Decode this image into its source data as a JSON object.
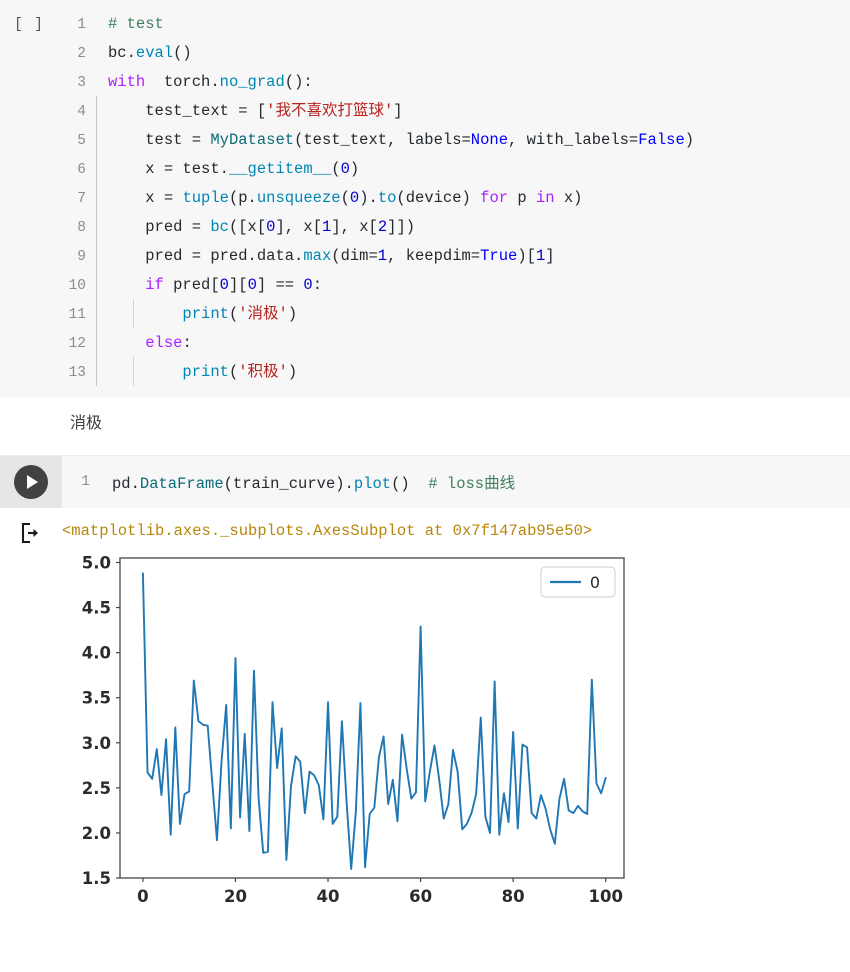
{
  "notebook": {
    "cell1": {
      "prompt": "[ ]",
      "lines": [
        {
          "n": "1",
          "indent": 0,
          "tokens": [
            {
              "t": "# test",
              "c": "tok-com"
            }
          ]
        },
        {
          "n": "2",
          "indent": 0,
          "tokens": [
            {
              "t": "bc.",
              "c": "tok-plain"
            },
            {
              "t": "eval",
              "c": "tok-fn"
            },
            {
              "t": "()",
              "c": "tok-plain"
            }
          ]
        },
        {
          "n": "3",
          "indent": 0,
          "tokens": [
            {
              "t": "with",
              "c": "tok-kw"
            },
            {
              "t": "  torch.",
              "c": "tok-plain"
            },
            {
              "t": "no_grad",
              "c": "tok-fn"
            },
            {
              "t": "():",
              "c": "tok-plain"
            }
          ]
        },
        {
          "n": "4",
          "indent": 1,
          "tokens": [
            {
              "t": "test_text = [",
              "c": "tok-plain"
            },
            {
              "t": "'我不喜欢打篮球'",
              "c": "tok-str"
            },
            {
              "t": "]",
              "c": "tok-plain"
            }
          ]
        },
        {
          "n": "5",
          "indent": 1,
          "tokens": [
            {
              "t": "test = ",
              "c": "tok-plain"
            },
            {
              "t": "MyDataset",
              "c": "tok-cls"
            },
            {
              "t": "(test_text, labels=",
              "c": "tok-plain"
            },
            {
              "t": "None",
              "c": "tok-bool"
            },
            {
              "t": ", with_labels=",
              "c": "tok-plain"
            },
            {
              "t": "False",
              "c": "tok-bool"
            },
            {
              "t": ")",
              "c": "tok-plain"
            }
          ]
        },
        {
          "n": "6",
          "indent": 1,
          "tokens": [
            {
              "t": "x = test.",
              "c": "tok-plain"
            },
            {
              "t": "__getitem__",
              "c": "tok-fn"
            },
            {
              "t": "(",
              "c": "tok-plain"
            },
            {
              "t": "0",
              "c": "tok-num"
            },
            {
              "t": ")",
              "c": "tok-plain"
            }
          ]
        },
        {
          "n": "7",
          "indent": 1,
          "tokens": [
            {
              "t": "x = ",
              "c": "tok-plain"
            },
            {
              "t": "tuple",
              "c": "tok-fn"
            },
            {
              "t": "(p.",
              "c": "tok-plain"
            },
            {
              "t": "unsqueeze",
              "c": "tok-fn"
            },
            {
              "t": "(",
              "c": "tok-plain"
            },
            {
              "t": "0",
              "c": "tok-num"
            },
            {
              "t": ").",
              "c": "tok-plain"
            },
            {
              "t": "to",
              "c": "tok-fn"
            },
            {
              "t": "(device) ",
              "c": "tok-plain"
            },
            {
              "t": "for",
              "c": "tok-kw"
            },
            {
              "t": " p ",
              "c": "tok-plain"
            },
            {
              "t": "in",
              "c": "tok-kw"
            },
            {
              "t": " x)",
              "c": "tok-plain"
            }
          ]
        },
        {
          "n": "8",
          "indent": 1,
          "tokens": [
            {
              "t": "pred = ",
              "c": "tok-plain"
            },
            {
              "t": "bc",
              "c": "tok-fn"
            },
            {
              "t": "([x[",
              "c": "tok-plain"
            },
            {
              "t": "0",
              "c": "tok-num"
            },
            {
              "t": "], x[",
              "c": "tok-plain"
            },
            {
              "t": "1",
              "c": "tok-num"
            },
            {
              "t": "], x[",
              "c": "tok-plain"
            },
            {
              "t": "2",
              "c": "tok-num"
            },
            {
              "t": "]])",
              "c": "tok-plain"
            }
          ]
        },
        {
          "n": "9",
          "indent": 1,
          "tokens": [
            {
              "t": "pred = pred.data.",
              "c": "tok-plain"
            },
            {
              "t": "max",
              "c": "tok-fn"
            },
            {
              "t": "(dim=",
              "c": "tok-plain"
            },
            {
              "t": "1",
              "c": "tok-num"
            },
            {
              "t": ", keepdim=",
              "c": "tok-plain"
            },
            {
              "t": "True",
              "c": "tok-bool"
            },
            {
              "t": ")[",
              "c": "tok-plain"
            },
            {
              "t": "1",
              "c": "tok-num"
            },
            {
              "t": "]",
              "c": "tok-plain"
            }
          ]
        },
        {
          "n": "10",
          "indent": 1,
          "tokens": [
            {
              "t": "if",
              "c": "tok-kw"
            },
            {
              "t": " pred[",
              "c": "tok-plain"
            },
            {
              "t": "0",
              "c": "tok-num"
            },
            {
              "t": "][",
              "c": "tok-plain"
            },
            {
              "t": "0",
              "c": "tok-num"
            },
            {
              "t": "] == ",
              "c": "tok-plain"
            },
            {
              "t": "0",
              "c": "tok-num"
            },
            {
              "t": ":",
              "c": "tok-plain"
            }
          ]
        },
        {
          "n": "11",
          "indent": 2,
          "tokens": [
            {
              "t": "print",
              "c": "tok-fn"
            },
            {
              "t": "(",
              "c": "tok-plain"
            },
            {
              "t": "'消极'",
              "c": "tok-str"
            },
            {
              "t": ")",
              "c": "tok-plain"
            }
          ]
        },
        {
          "n": "12",
          "indent": 1,
          "tokens": [
            {
              "t": "else",
              "c": "tok-kw"
            },
            {
              "t": ":",
              "c": "tok-plain"
            }
          ]
        },
        {
          "n": "13",
          "indent": 2,
          "tokens": [
            {
              "t": "print",
              "c": "tok-fn"
            },
            {
              "t": "(",
              "c": "tok-plain"
            },
            {
              "t": "'积极'",
              "c": "tok-str"
            },
            {
              "t": ")",
              "c": "tok-plain"
            }
          ]
        }
      ],
      "stdout": "消极"
    },
    "cell2": {
      "run_button_label": "run-cell",
      "line_number": "1",
      "code_tokens": [
        {
          "t": "pd.",
          "c": "tok-plain"
        },
        {
          "t": "DataFrame",
          "c": "tok-cls"
        },
        {
          "t": "(train_curve).",
          "c": "tok-plain"
        },
        {
          "t": "plot",
          "c": "tok-fn"
        },
        {
          "t": "()  ",
          "c": "tok-plain"
        },
        {
          "t": "# loss曲线",
          "c": "tok-com"
        }
      ],
      "output_repr": "<matplotlib.axes._subplots.AxesSubplot at 0x7f147ab95e50>"
    }
  },
  "colors": {
    "line": "#1f77b4",
    "axis": "#444444",
    "cell_bg": "#f7f7f7",
    "gutter_bg": "#e6e6e6",
    "run_btn": "#424242",
    "comment": "#3f7f5f",
    "string": "#ba2121",
    "keyword": "#aa22ff",
    "builtin": "#0000ff",
    "number": "#0000cf",
    "function": "#0086b3",
    "repr_text": "#b8860b"
  },
  "chart_data": {
    "type": "line",
    "title": "",
    "xlabel": "",
    "ylabel": "",
    "xlim": [
      -4.95,
      103.95
    ],
    "ylim": [
      1.5,
      5.05
    ],
    "xticks": [
      0,
      20,
      40,
      60,
      80,
      100
    ],
    "yticks": [
      1.5,
      2.0,
      2.5,
      3.0,
      3.5,
      4.0,
      4.5,
      5.0
    ],
    "grid": false,
    "legend": {
      "position": "upper right",
      "entries": [
        "0"
      ]
    },
    "series": [
      {
        "name": "0",
        "color": "#1f77b4",
        "x": [
          0,
          1,
          2,
          3,
          4,
          5,
          6,
          7,
          8,
          9,
          10,
          11,
          12,
          13,
          14,
          15,
          16,
          17,
          18,
          19,
          20,
          21,
          22,
          23,
          24,
          25,
          26,
          27,
          28,
          29,
          30,
          31,
          32,
          33,
          34,
          35,
          36,
          37,
          38,
          39,
          40,
          41,
          42,
          43,
          44,
          45,
          46,
          47,
          48,
          49,
          50,
          51,
          52,
          53,
          54,
          55,
          56,
          57,
          58,
          59,
          60,
          61,
          62,
          63,
          64,
          65,
          66,
          67,
          68,
          69,
          70,
          71,
          72,
          73,
          74,
          75,
          76,
          77,
          78,
          79,
          80,
          81,
          82,
          83,
          84,
          85,
          86,
          87,
          88,
          89,
          90,
          91,
          92,
          93,
          94,
          95,
          96,
          97,
          98,
          99,
          100
        ],
        "values": [
          4.88,
          2.67,
          2.6,
          2.93,
          2.42,
          3.04,
          1.98,
          3.17,
          2.1,
          2.43,
          2.46,
          3.69,
          3.24,
          3.2,
          3.19,
          2.55,
          1.92,
          2.8,
          3.42,
          2.05,
          3.94,
          2.17,
          3.1,
          2.02,
          3.8,
          2.38,
          1.78,
          1.79,
          3.45,
          2.72,
          3.16,
          1.7,
          2.52,
          2.85,
          2.79,
          2.22,
          2.68,
          2.64,
          2.53,
          2.15,
          3.45,
          2.1,
          2.18,
          3.24,
          2.35,
          1.6,
          2.23,
          3.44,
          1.62,
          2.21,
          2.28,
          2.84,
          3.07,
          2.32,
          2.59,
          2.13,
          3.09,
          2.71,
          2.38,
          2.45,
          4.29,
          2.35,
          2.68,
          2.97,
          2.6,
          2.16,
          2.32,
          2.92,
          2.68,
          2.04,
          2.1,
          2.22,
          2.43,
          3.28,
          2.18,
          2.0,
          3.68,
          1.98,
          2.44,
          2.12,
          3.12,
          2.05,
          2.98,
          2.95,
          2.22,
          2.16,
          2.42,
          2.27,
          2.04,
          1.88,
          2.38,
          2.6,
          2.25,
          2.22,
          2.3,
          2.24,
          2.21,
          3.7,
          2.55,
          2.44,
          2.61
        ]
      }
    ]
  }
}
